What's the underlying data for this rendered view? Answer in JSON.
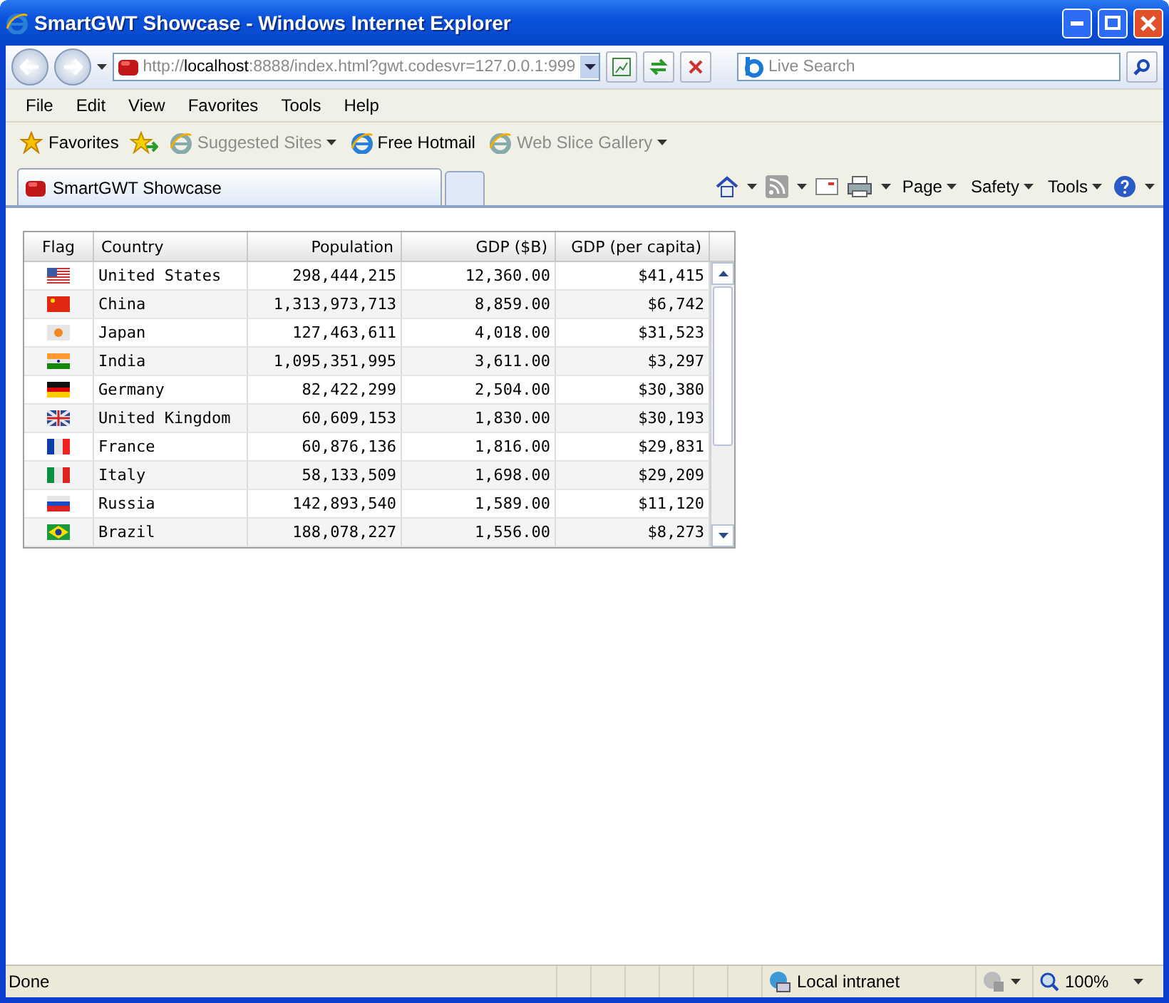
{
  "window": {
    "title": "SmartGWT Showcase - Windows Internet Explorer"
  },
  "address": {
    "scheme": "http://",
    "host": "localhost",
    "rest": ":8888/index.html?gwt.codesvr=127.0.0.1:999"
  },
  "search": {
    "placeholder": "Live Search"
  },
  "menu": [
    "File",
    "Edit",
    "View",
    "Favorites",
    "Tools",
    "Help"
  ],
  "favorites_bar": {
    "label": "Favorites",
    "links": [
      {
        "label": "Suggested Sites",
        "disabled": true,
        "dropdown": true
      },
      {
        "label": "Free Hotmail",
        "disabled": false,
        "dropdown": false
      },
      {
        "label": "Web Slice Gallery",
        "disabled": true,
        "dropdown": true
      }
    ]
  },
  "tabs": [
    {
      "label": "SmartGWT Showcase",
      "selected": true
    }
  ],
  "command_bar": [
    "Page",
    "Safety",
    "Tools"
  ],
  "grid": {
    "columns": [
      "Flag",
      "Country",
      "Population",
      "GDP ($B)",
      "GDP (per capita)"
    ],
    "rows": [
      {
        "kind": "us",
        "cells": [
          "",
          "United States",
          "298,444,215",
          "12,360.00",
          "$41,415"
        ]
      },
      {
        "kind": "cn",
        "cells": [
          "",
          "China",
          "1,313,973,713",
          "8,859.00",
          "$6,742"
        ]
      },
      {
        "kind": "jp",
        "cells": [
          "",
          "Japan",
          "127,463,611",
          "4,018.00",
          "$31,523"
        ]
      },
      {
        "kind": "in",
        "cells": [
          "",
          "India",
          "1,095,351,995",
          "3,611.00",
          "$3,297"
        ]
      },
      {
        "kind": "de",
        "cells": [
          "",
          "Germany",
          "82,422,299",
          "2,504.00",
          "$30,380"
        ]
      },
      {
        "kind": "gb",
        "cells": [
          "",
          "United Kingdom",
          "60,609,153",
          "1,830.00",
          "$30,193"
        ]
      },
      {
        "kind": "fr",
        "cells": [
          "",
          "France",
          "60,876,136",
          "1,816.00",
          "$29,831"
        ]
      },
      {
        "kind": "it",
        "cells": [
          "",
          "Italy",
          "58,133,509",
          "1,698.00",
          "$29,209"
        ]
      },
      {
        "kind": "ru",
        "cells": [
          "",
          "Russia",
          "142,893,540",
          "1,589.00",
          "$11,120"
        ]
      },
      {
        "kind": "br",
        "cells": [
          "",
          "Brazil",
          "188,078,227",
          "1,556.00",
          "$8,273"
        ]
      }
    ]
  },
  "status_bar": {
    "status": "Done",
    "zone": "Local intranet",
    "zoom": "100%"
  }
}
